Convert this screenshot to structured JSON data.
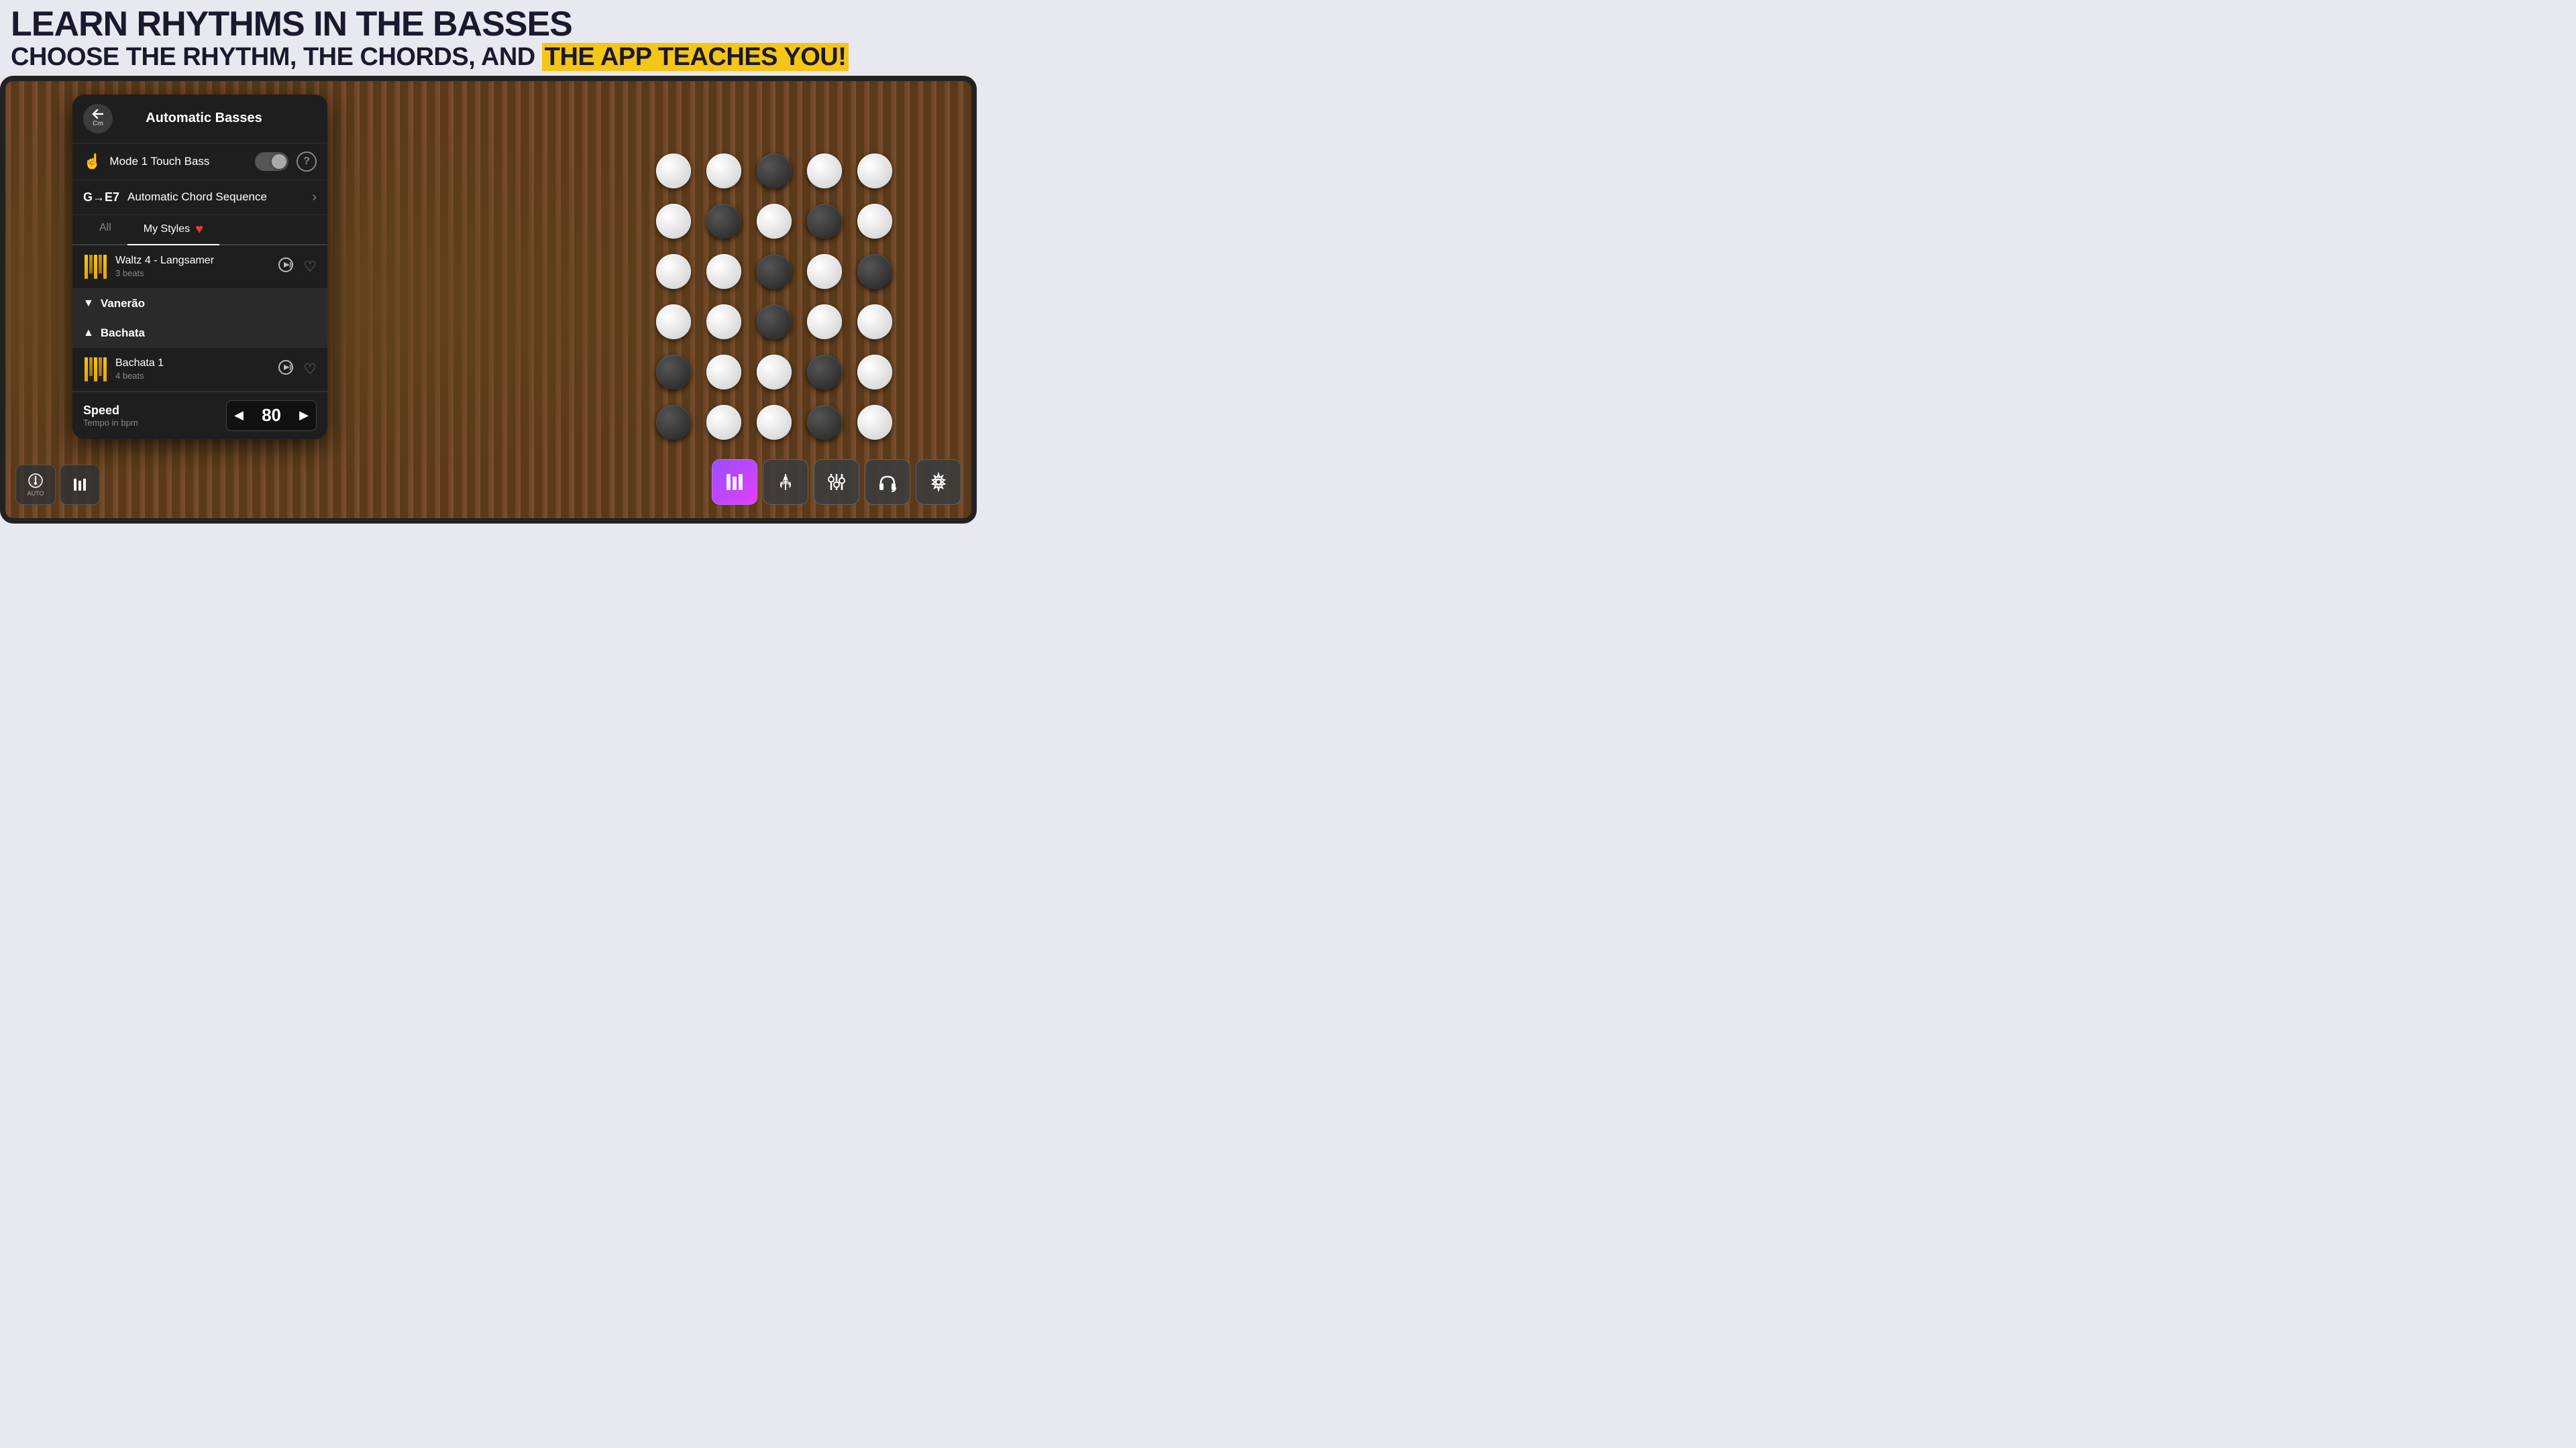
{
  "header": {
    "line1": "LEARN RHYTHMS IN THE BASSES",
    "line2_prefix": "CHOOSE THE RHYTHM, THE CHORDS, AND ",
    "line2_highlight": "THE APP TEACHES YOU!"
  },
  "modal": {
    "title": "Automatic Basses",
    "back_label": "Cm",
    "mode1_label": "Mode 1 Touch Bass",
    "chord_seq_label": "Automatic Chord Sequence",
    "help_label": "?",
    "tabs": [
      {
        "label": "All",
        "active": false
      },
      {
        "label": "My Styles",
        "active": true
      }
    ],
    "items": [
      {
        "title": "Waltz 4 - Langsamer",
        "subtitle": "3 beats",
        "favorited": false
      }
    ],
    "sections": [
      {
        "label": "Vanerão",
        "expanded": false,
        "items": []
      },
      {
        "label": "Bachata",
        "expanded": true,
        "items": [
          {
            "title": "Bachata 1",
            "subtitle": "4 beats",
            "favorited": false
          }
        ]
      }
    ],
    "speed": {
      "label": "Speed",
      "sublabel": "Tempo in bpm",
      "value": "80"
    }
  },
  "toolbar": {
    "items": [
      {
        "label": "AUTO",
        "icon": "metronome"
      },
      {
        "label": "",
        "icon": "chord"
      }
    ]
  },
  "right_toolbar": {
    "items": [
      {
        "label": "styles",
        "active": true
      },
      {
        "label": "rocket",
        "active": false
      },
      {
        "label": "mixer",
        "active": false
      },
      {
        "label": "headphones",
        "active": false
      },
      {
        "label": "settings",
        "active": false
      }
    ]
  }
}
